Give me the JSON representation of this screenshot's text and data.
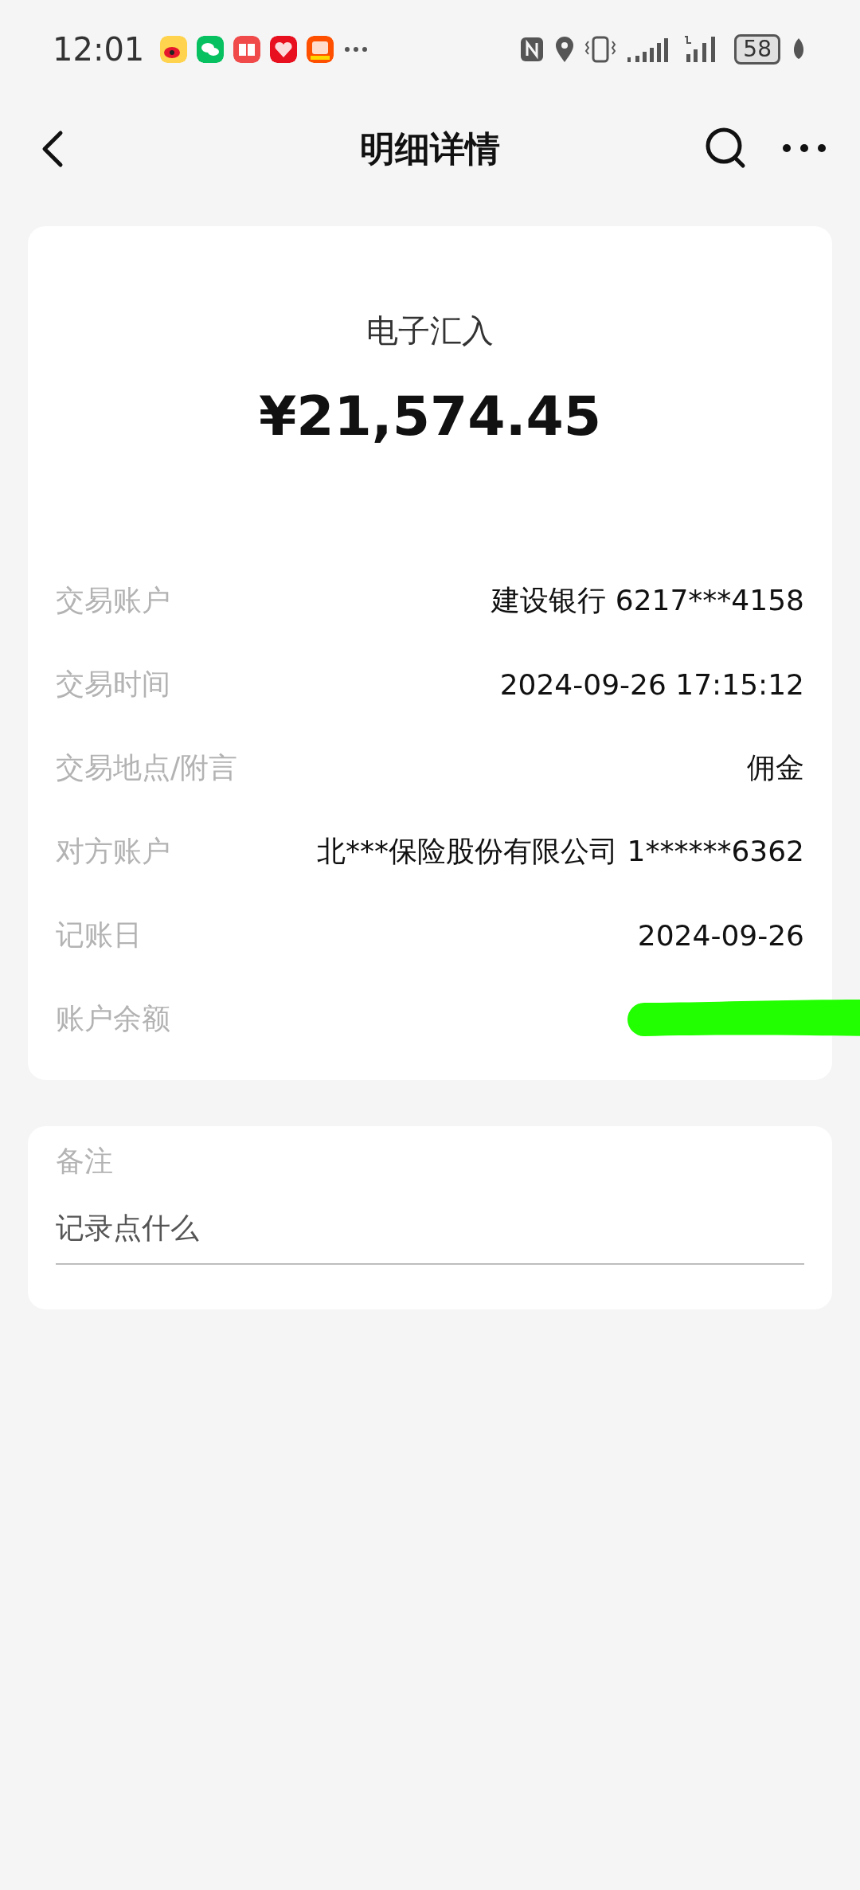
{
  "status_bar": {
    "time": "12:01",
    "battery": "58"
  },
  "nav": {
    "title": "明细详情"
  },
  "summary": {
    "type": "电子汇入",
    "amount": "¥21,574.45"
  },
  "details": [
    {
      "label": "交易账户",
      "value": "建设银行 6217***4158"
    },
    {
      "label": "交易时间",
      "value": "2024-09-26 17:15:12"
    },
    {
      "label": "交易地点/附言",
      "value": "佣金"
    },
    {
      "label": "对方账户",
      "value": "北***保险股份有限公司 1******6362"
    },
    {
      "label": "记账日",
      "value": "2024-09-26"
    },
    {
      "label": "账户余额",
      "kind": "redacted"
    }
  ],
  "note": {
    "label": "备注",
    "placeholder": "记录点什么"
  }
}
